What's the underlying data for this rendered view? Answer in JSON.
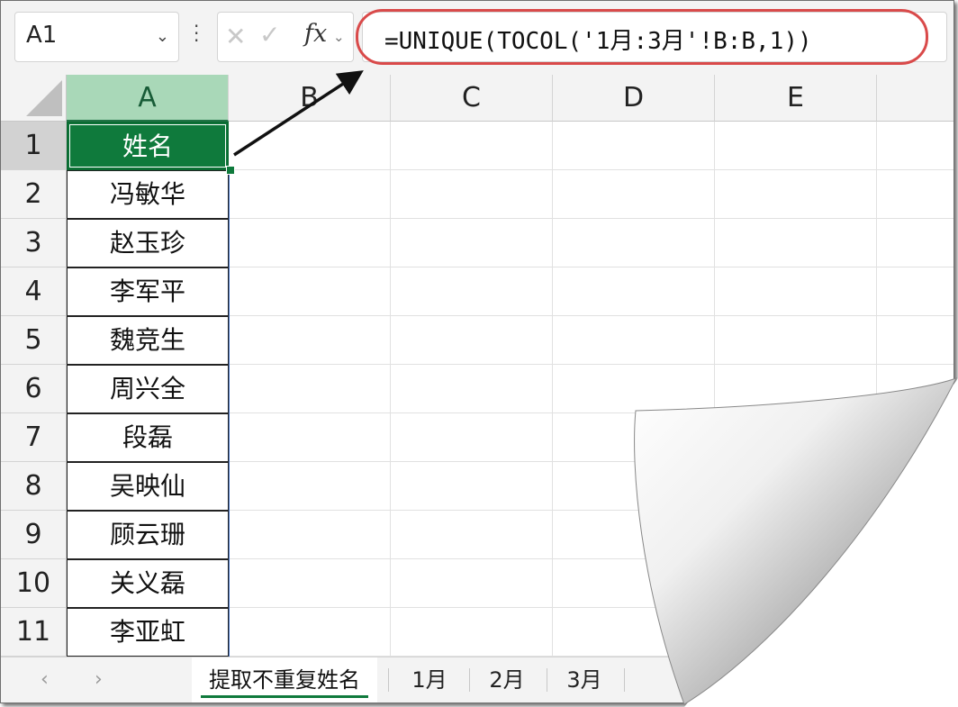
{
  "name_box": {
    "value": "A1"
  },
  "formula_bar": {
    "formula": "=UNIQUE(TOCOL('1月:3月'!B:B,1))",
    "fx_label": "fx"
  },
  "columns": [
    "A",
    "B",
    "C",
    "D",
    "E"
  ],
  "rows": [
    "1",
    "2",
    "3",
    "4",
    "5",
    "6",
    "7",
    "8",
    "9",
    "10",
    "11"
  ],
  "names": [
    "姓名",
    "冯敏华",
    "赵玉珍",
    "李军平",
    "魏竞生",
    "周兴全",
    "段磊",
    "吴映仙",
    "顾云珊",
    "关义磊",
    "李亚虹"
  ],
  "sheet_tabs": [
    {
      "label": "提取不重复姓名",
      "active": true
    },
    {
      "label": "1月",
      "active": false
    },
    {
      "label": "2月",
      "active": false
    },
    {
      "label": "3月",
      "active": false
    }
  ],
  "colors": {
    "header_cell": "#0f7a3c",
    "selected_column": "#a9d8b8",
    "formula_highlight": "#d94a4a"
  }
}
